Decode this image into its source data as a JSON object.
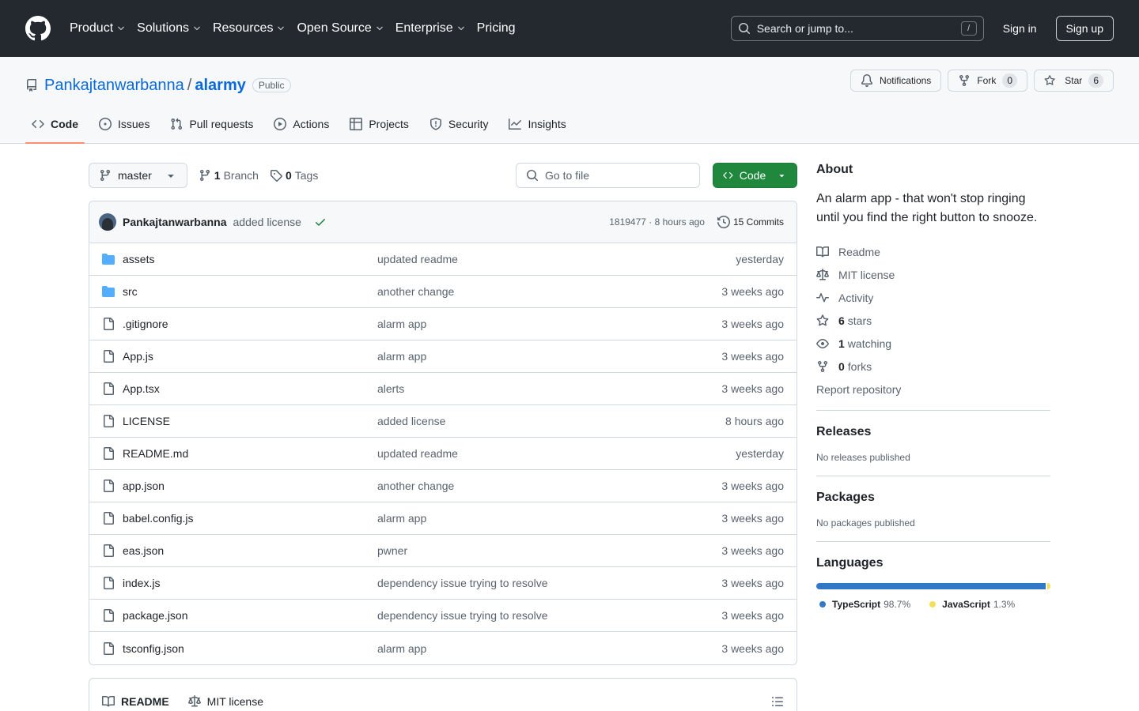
{
  "header": {
    "nav": [
      {
        "label": "Product",
        "dropdown": true
      },
      {
        "label": "Solutions",
        "dropdown": true
      },
      {
        "label": "Resources",
        "dropdown": true
      },
      {
        "label": "Open Source",
        "dropdown": true
      },
      {
        "label": "Enterprise",
        "dropdown": true
      },
      {
        "label": "Pricing",
        "dropdown": false
      }
    ],
    "search_placeholder": "Search or jump to...",
    "search_shortcut": "/",
    "sign_in": "Sign in",
    "sign_up": "Sign up"
  },
  "repo": {
    "owner": "Pankajtanwarbanna",
    "separator": "/",
    "name": "alarmy",
    "visibility": "Public",
    "notifications_label": "Notifications",
    "fork_label": "Fork",
    "fork_count": "0",
    "star_label": "Star",
    "star_count": "6",
    "tabs": [
      {
        "label": "Code",
        "icon": "code-icon",
        "active": true
      },
      {
        "label": "Issues",
        "icon": "issue-icon",
        "active": false
      },
      {
        "label": "Pull requests",
        "icon": "pull-request-icon",
        "active": false
      },
      {
        "label": "Actions",
        "icon": "play-icon",
        "active": false
      },
      {
        "label": "Projects",
        "icon": "table-icon",
        "active": false
      },
      {
        "label": "Security",
        "icon": "shield-icon",
        "active": false
      },
      {
        "label": "Insights",
        "icon": "graph-icon",
        "active": false
      }
    ]
  },
  "toolbar": {
    "branch": "master",
    "branch_count": "1",
    "branch_label": "Branch",
    "tag_count": "0",
    "tag_label": "Tags",
    "goto_placeholder": "Go to file",
    "code_button": "Code"
  },
  "commit": {
    "author": "Pankajtanwarbanna",
    "message": "added license",
    "meta": "1819477 · 8 hours ago",
    "commits_label": "15 Commits"
  },
  "files": [
    {
      "name": "assets",
      "type": "dir",
      "message": "updated readme",
      "time": "yesterday"
    },
    {
      "name": "src",
      "type": "dir",
      "message": "another change",
      "time": "3 weeks ago"
    },
    {
      "name": ".gitignore",
      "type": "file",
      "message": "alarm app",
      "time": "3 weeks ago"
    },
    {
      "name": "App.js",
      "type": "file",
      "message": "alarm app",
      "time": "3 weeks ago"
    },
    {
      "name": "App.tsx",
      "type": "file",
      "message": "alerts",
      "time": "3 weeks ago"
    },
    {
      "name": "LICENSE",
      "type": "file",
      "message": "added license",
      "time": "8 hours ago"
    },
    {
      "name": "README.md",
      "type": "file",
      "message": "updated readme",
      "time": "yesterday"
    },
    {
      "name": "app.json",
      "type": "file",
      "message": "another change",
      "time": "3 weeks ago"
    },
    {
      "name": "babel.config.js",
      "type": "file",
      "message": "alarm app",
      "time": "3 weeks ago"
    },
    {
      "name": "eas.json",
      "type": "file",
      "message": "pwner",
      "time": "3 weeks ago"
    },
    {
      "name": "index.js",
      "type": "file",
      "message": "dependency issue trying to resolve",
      "time": "3 weeks ago"
    },
    {
      "name": "package.json",
      "type": "file",
      "message": "dependency issue trying to resolve",
      "time": "3 weeks ago"
    },
    {
      "name": "tsconfig.json",
      "type": "file",
      "message": "alarm app",
      "time": "3 weeks ago"
    }
  ],
  "readme": {
    "tab_readme": "README",
    "tab_license": "MIT license"
  },
  "sidebar": {
    "about_title": "About",
    "description": "An alarm app - that won't stop ringing until you find the right button to snooze.",
    "links": {
      "readme": "Readme",
      "license": "MIT license",
      "activity": "Activity",
      "stars_count": "6",
      "stars_label": "stars",
      "watching_count": "1",
      "watching_label": "watching",
      "forks_count": "0",
      "forks_label": "forks",
      "report": "Report repository"
    },
    "releases_title": "Releases",
    "releases_empty": "No releases published",
    "packages_title": "Packages",
    "packages_empty": "No packages published",
    "languages_title": "Languages",
    "languages": [
      {
        "name": "TypeScript",
        "percent": "98.7%",
        "value": 98.7,
        "color": "#3178c6"
      },
      {
        "name": "JavaScript",
        "percent": "1.3%",
        "value": 1.3,
        "color": "#f1e05a"
      }
    ]
  }
}
